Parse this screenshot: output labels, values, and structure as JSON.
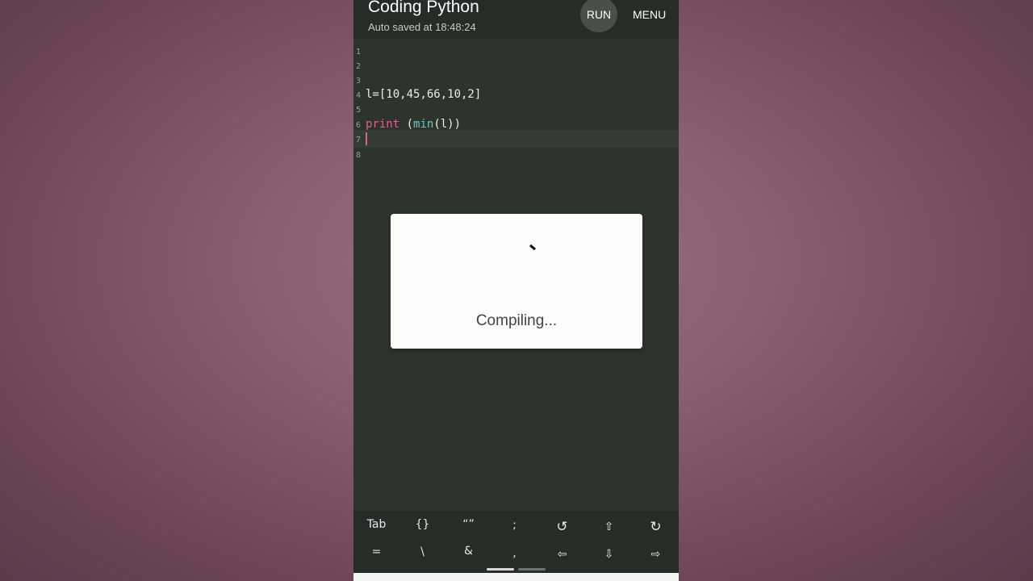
{
  "app": {
    "title": "Coding Python",
    "subtitle": "Auto saved at 18:48:24",
    "run_label": "RUN",
    "menu_label": "MENU"
  },
  "editor": {
    "lines": [
      {
        "number": "1",
        "code": ""
      },
      {
        "number": "2",
        "code": ""
      },
      {
        "number": "3",
        "code": ""
      },
      {
        "number": "4",
        "code": "l=[10,45,66,10,2]"
      },
      {
        "number": "5",
        "code": ""
      },
      {
        "number": "6",
        "code_keyword": "print",
        "code_space": " (",
        "code_func": "min",
        "code_rest": "(l))"
      },
      {
        "number": "7",
        "code": ""
      },
      {
        "number": "8",
        "code": ""
      }
    ],
    "current_line": 7
  },
  "dialog": {
    "message": "Compiling..."
  },
  "keyboard": {
    "row1": [
      "Tab",
      "{}",
      "“”",
      ";",
      "↺",
      "⇧",
      "↻"
    ],
    "row2": [
      "=",
      "\\",
      "&",
      ",",
      "⇦",
      "⇩",
      "⇨"
    ]
  },
  "colors": {
    "keyword": "#e0609a",
    "function": "#6cc3c5",
    "editor_bg": "#2c342c"
  }
}
